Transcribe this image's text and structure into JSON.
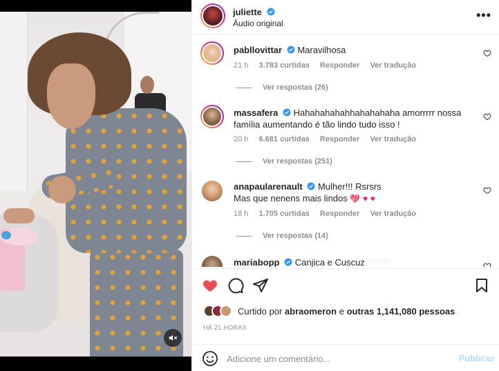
{
  "header": {
    "username": "juliette",
    "subtitle": "Áudio original",
    "more_icon": "more-horizontal-icon"
  },
  "media": {
    "mute_icon": "speaker-muted-icon"
  },
  "comments": [
    {
      "username": "pabllovittar",
      "text": "Maravilhosa",
      "time": "21 h",
      "likes": "3.783 curtidas",
      "reply": "Responder",
      "translate": "Ver tradução",
      "view_replies": "Ver respostas (26)"
    },
    {
      "username": "massafera",
      "text": "Hahahahahahhahahahaha amorrrrr nossa família aumentando é tão lindo tudo isso !",
      "time": "20 h",
      "likes": "6.681 curtidas",
      "reply": "Responder",
      "translate": "Ver tradução",
      "view_replies": "Ver respostas (251)"
    },
    {
      "username": "anapaularenault",
      "text": "Mulher!!! Rsrsrs",
      "text2": "Mas que nenens mais lindos",
      "time": "18 h",
      "likes": "1.705 curtidas",
      "reply": "Responder",
      "translate": "Ver tradução",
      "view_replies": "Ver respostas (14)"
    },
    {
      "username": "mariabopp",
      "text": "Canjica e Cuscuz"
    }
  ],
  "likes": {
    "prefix": "Curtido por",
    "user": "abraomeron",
    "middle": "e",
    "others": "outras 1,141,080 pessoas"
  },
  "timestamp": "HÁ 21 HORAS",
  "add_comment": {
    "placeholder": "Adicione um comentário...",
    "publish_label": "Publicar"
  },
  "colors": {
    "like_red": "#ed4956",
    "verified_blue": "#3897f0",
    "publish_disabled": "#b3dbff"
  }
}
